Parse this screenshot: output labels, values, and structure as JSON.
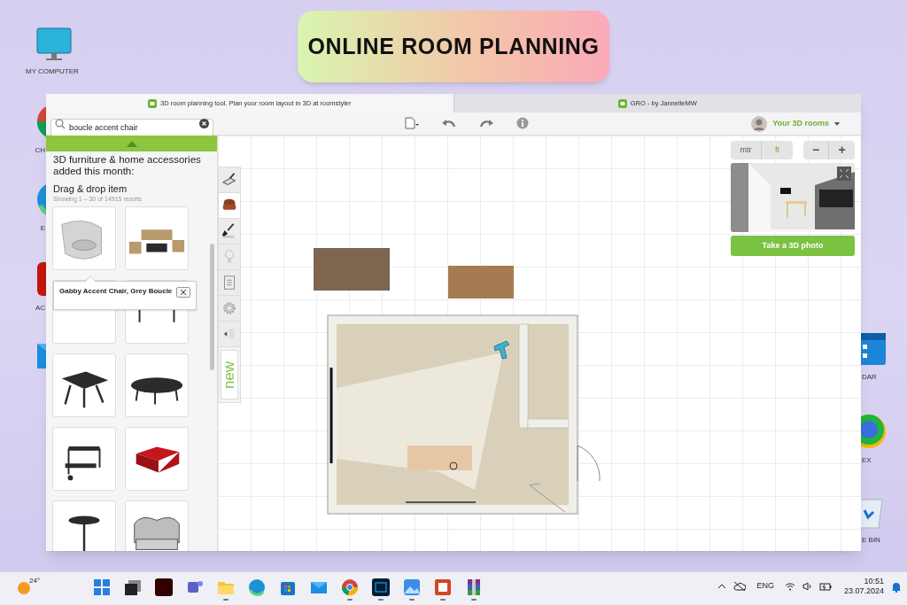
{
  "banner": {
    "title": "ONLINE ROOM PLANNING"
  },
  "desktop_icons": [
    {
      "label": "MY COMPUTER",
      "kind": "monitor"
    },
    {
      "label": "CH",
      "kind": "chrome"
    },
    {
      "label": "E",
      "kind": "edge"
    },
    {
      "label": "AC",
      "kind": "acrobat"
    },
    {
      "kind": "mail"
    },
    {
      "label": "DAR",
      "kind": "calendar"
    },
    {
      "label": "EX",
      "kind": "yandex"
    },
    {
      "label": "E BIN",
      "kind": "bin"
    }
  ],
  "browser_tabs": [
    {
      "title": "3D room planning tool. Plan your room layout in 3D at roomstyler",
      "selected": true
    },
    {
      "title": "GRO - by JannelleMW",
      "selected": false
    }
  ],
  "toolbar": {
    "search": {
      "value": "boucle accent chair"
    },
    "account": "Your 3D rooms"
  },
  "catalog": {
    "heading": "3D furniture & home accessories added this month:",
    "subheading": "Drag & drop item",
    "results": "Showing 1 – 30 of 14915 results",
    "items": [
      {
        "kind": "armchair"
      },
      {
        "kind": "patio-set"
      },
      {
        "kind": "dining-set"
      },
      {
        "kind": "bench"
      },
      {
        "kind": "square-table"
      },
      {
        "kind": "oval-table"
      },
      {
        "kind": "cart"
      },
      {
        "kind": "ottoman"
      },
      {
        "kind": "bar-table"
      },
      {
        "kind": "loveseat"
      }
    ],
    "tooltip": "Gabby Accent Chair, Grey Boucle"
  },
  "tool_rail": {
    "tabs": [
      {
        "kind": "trowel",
        "selected": false
      },
      {
        "kind": "chair",
        "selected": true
      },
      {
        "kind": "brush",
        "selected": false
      },
      {
        "kind": "bulb",
        "selected": false
      },
      {
        "kind": "clipboard",
        "selected": false
      },
      {
        "kind": "gear",
        "selected": false
      },
      {
        "kind": "collapse",
        "selected": false
      }
    ],
    "new_label": "new"
  },
  "units": [
    {
      "label": "mtr",
      "selected": false
    },
    {
      "label": "ft",
      "selected": true
    }
  ],
  "zoom_buttons": [
    "−",
    "+"
  ],
  "photo_button": "Take a 3D photo",
  "taskbar": {
    "weather": "24°",
    "apps": [
      {
        "kind": "start",
        "running": false
      },
      {
        "kind": "taskview",
        "running": false
      },
      {
        "kind": "illustrator",
        "running": false
      },
      {
        "kind": "teams",
        "running": false
      },
      {
        "kind": "explorer",
        "running": true
      },
      {
        "kind": "edge",
        "running": false
      },
      {
        "kind": "store",
        "running": false
      },
      {
        "kind": "mail",
        "running": false
      },
      {
        "kind": "chrome",
        "running": true
      },
      {
        "kind": "photoshop",
        "running": true
      },
      {
        "kind": "photos",
        "running": true
      },
      {
        "kind": "powerpoint",
        "running": true
      },
      {
        "kind": "winrar",
        "running": true
      }
    ],
    "language": "ENG",
    "time": "10:51",
    "date": "23.07.2024"
  }
}
